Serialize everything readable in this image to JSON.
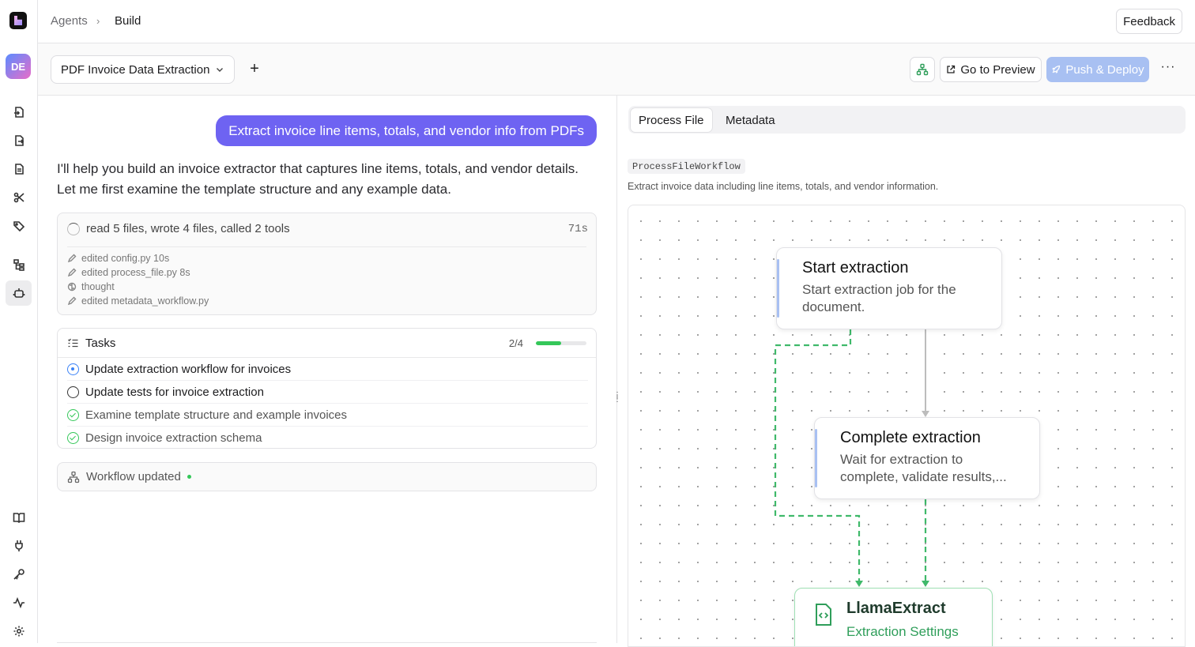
{
  "app": {
    "avatar_initials": "DE",
    "accent_color": "#6e63f2",
    "success_color": "#34c759"
  },
  "breadcrumb": {
    "root": "Agents",
    "separator": "›",
    "current": "Build"
  },
  "header": {
    "feedback_label": "Feedback"
  },
  "sidebar": {
    "icons": [
      "file-import-icon",
      "file-export-icon",
      "document-icon",
      "scissors-icon",
      "tags-icon",
      "workflow-tree-icon",
      "robot-icon",
      "book-icon",
      "plug-icon",
      "key-icon",
      "activity-icon",
      "settings-icon"
    ],
    "active": "robot-icon"
  },
  "toolbar": {
    "agent_name": "PDF Invoice Data Extraction",
    "add_label": "+",
    "preview_label": "Go to Preview",
    "deploy_label": "Push & Deploy",
    "more_label": "···"
  },
  "chat": {
    "user_message": "Extract invoice line items, totals, and vendor info from PDFs",
    "assistant_line1": "I'll help you build an invoice extractor that captures line items, totals, and vendor details.",
    "assistant_line2": "Let me first examine the template structure and any example data.",
    "activity": {
      "summary": "read 5 files, wrote 4 files, called 2 tools",
      "elapsed": "71s",
      "logs": [
        {
          "icon": "pencil-icon",
          "text": "edited config.py 10s"
        },
        {
          "icon": "pencil-icon",
          "text": "edited process_file.py 8s"
        },
        {
          "icon": "brain-icon",
          "text": "thought"
        },
        {
          "icon": "pencil-icon",
          "text": "edited metadata_workflow.py"
        }
      ]
    },
    "tasks": {
      "title": "Tasks",
      "count": "2/4",
      "progress": 0.5,
      "items": [
        {
          "label": "Update extraction workflow for invoices",
          "status": "in-progress"
        },
        {
          "label": "Update tests for invoice extraction",
          "status": "pending"
        },
        {
          "label": "Examine template structure and example invoices",
          "status": "done"
        },
        {
          "label": "Design invoice extraction schema",
          "status": "done"
        }
      ]
    },
    "workflow_status": "Workflow updated"
  },
  "workflow_panel": {
    "tabs": [
      "Process File",
      "Metadata"
    ],
    "active_tab": "Process File",
    "workflow_id": "ProcessFileWorkflow",
    "description": "Extract invoice data including line items, totals, and vendor information.",
    "nodes": [
      {
        "title": "Start extraction",
        "description": "Start extraction job for the document."
      },
      {
        "title": "Complete extraction",
        "description": "Wait for extraction to complete, validate results,..."
      },
      {
        "title": "LlamaExtract",
        "description": "Extraction Settings"
      }
    ]
  }
}
